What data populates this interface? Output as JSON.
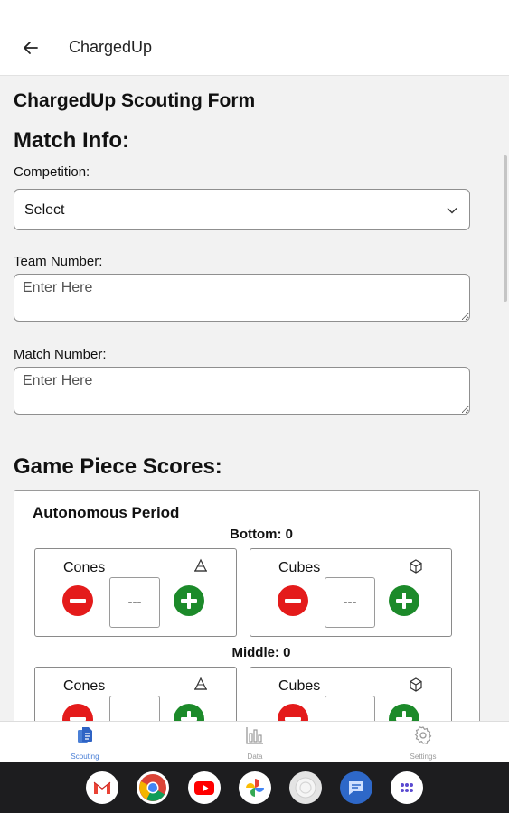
{
  "appbar": {
    "title": "ChargedUp",
    "back_icon": "arrow-left-icon"
  },
  "form": {
    "title": "ChargedUp Scouting Form",
    "match_info_title": "Match Info:",
    "competition": {
      "label": "Competition:",
      "value": "Select"
    },
    "team_number": {
      "label": "Team Number:",
      "placeholder": "Enter Here"
    },
    "match_number": {
      "label": "Match Number:",
      "placeholder": "Enter Here"
    },
    "game_piece_title": "Game Piece Scores:"
  },
  "autonomous": {
    "title": "Autonomous Period",
    "levels": [
      {
        "label": "Bottom: 0",
        "cones": {
          "label": "Cones",
          "count": "---"
        },
        "cubes": {
          "label": "Cubes",
          "count": "---"
        }
      },
      {
        "label": "Middle: 0",
        "cones": {
          "label": "Cones",
          "count": ""
        },
        "cubes": {
          "label": "Cubes",
          "count": ""
        }
      }
    ]
  },
  "bottom_nav": [
    {
      "label": "Scouting",
      "icon": "document-icon",
      "active": true
    },
    {
      "label": "Data",
      "icon": "bar-chart-icon",
      "active": false
    },
    {
      "label": "Settings",
      "icon": "gear-icon",
      "active": false
    }
  ],
  "dock": [
    "gmail-icon",
    "chrome-icon",
    "youtube-icon",
    "photos-icon",
    "camera-icon",
    "messages-icon",
    "app-drawer-icon"
  ],
  "colors": {
    "minus": "#e41b1b",
    "plus": "#1c8a2a",
    "active_nav": "#4a7fd6"
  }
}
